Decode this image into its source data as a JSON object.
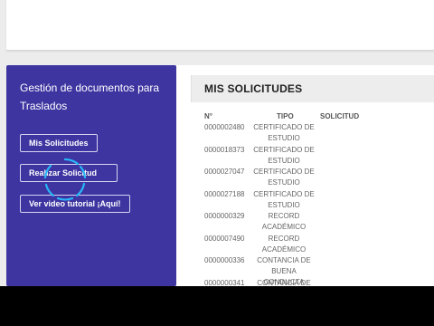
{
  "sidebar": {
    "title": "Gestión de documentos para Traslados",
    "buttons": [
      {
        "label": "Mis Solicitudes"
      },
      {
        "label": "Realizar Solicitud"
      },
      {
        "label": "Ver video tutorial ¡Aquí!"
      }
    ]
  },
  "main": {
    "title": "MIS SOLICITUDES",
    "columns": [
      "N°",
      "TIPO",
      "SOLICITUD"
    ],
    "rows": [
      {
        "num": "0000002480",
        "tipo": "CERTIFICADO DE ESTUDIO"
      },
      {
        "num": "0000018373",
        "tipo": "CERTIFICADO DE ESTUDIO"
      },
      {
        "num": "0000027047",
        "tipo": "CERTIFICADO DE ESTUDIO"
      },
      {
        "num": "0000027188",
        "tipo": "CERTIFICADO DE ESTUDIO"
      },
      {
        "num": "0000000329",
        "tipo": "RECORD ACADÉMICO"
      },
      {
        "num": "0000007490",
        "tipo": "RECORD ACADÉMICO"
      },
      {
        "num": "0000000336",
        "tipo": "CONTANCIA DE BUENA CONDUCTA"
      },
      {
        "num": "0000000341",
        "tipo": "CONTANCIA DE"
      }
    ]
  },
  "colors": {
    "sidebar_bg": "#3e35a1",
    "spinner": "#29b6f6",
    "page_bg": "#ececec"
  },
  "icons": {
    "loading": "loading-spinner-icon"
  }
}
